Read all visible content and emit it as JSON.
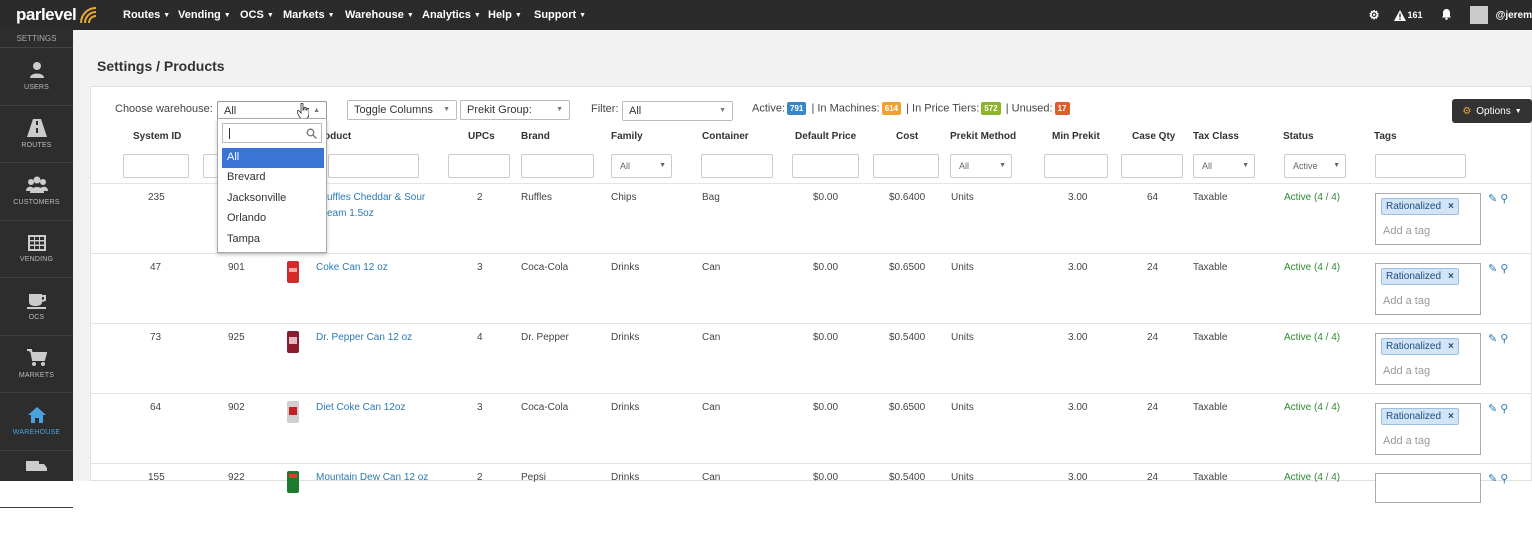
{
  "brand": {
    "name": "parlevel"
  },
  "nav": {
    "menus": [
      {
        "label": "Routes"
      },
      {
        "label": "Vending"
      },
      {
        "label": "OCS"
      },
      {
        "label": "Markets"
      },
      {
        "label": "Warehouse"
      },
      {
        "label": "Analytics"
      },
      {
        "label": "Help"
      },
      {
        "label": "Support"
      }
    ],
    "alerts_count": "161",
    "user": "@jerem"
  },
  "sidebar": {
    "header": "SETTINGS",
    "items": [
      {
        "label": "USERS",
        "icon": "user-icon"
      },
      {
        "label": "ROUTES",
        "icon": "road-icon"
      },
      {
        "label": "CUSTOMERS",
        "icon": "users-icon"
      },
      {
        "label": "VENDING",
        "icon": "grid-icon"
      },
      {
        "label": "OCS",
        "icon": "coffee-icon"
      },
      {
        "label": "MARKETS",
        "icon": "cart-icon"
      },
      {
        "label": "WAREHOUSE",
        "icon": "home-icon",
        "active": true
      },
      {
        "label": "",
        "icon": "truck-icon"
      }
    ]
  },
  "page": {
    "title": "Settings / Products"
  },
  "toolbar": {
    "warehouse_label": "Choose warehouse:",
    "warehouse_value": "All",
    "toggle_columns": "Toggle Columns",
    "prekit_group": "Prekit Group:",
    "filter_label": "Filter:",
    "filter_value": "All",
    "counts": {
      "active_label": "Active:",
      "active": "791",
      "in_machines_label": "| In Machines:",
      "in_machines": "614",
      "in_price_tiers_label": "| In Price Tiers:",
      "in_price_tiers": "572",
      "unused_label": "| Unused:",
      "unused": "17"
    },
    "options": "Options"
  },
  "warehouse_dropdown": {
    "search_placeholder": "",
    "options": [
      "All",
      "Brevard",
      "Jacksonville",
      "Orlando",
      "Tampa"
    ],
    "selected": "All"
  },
  "table": {
    "columns": [
      "System ID",
      "",
      "",
      "Product",
      "UPCs",
      "Brand",
      "Family",
      "Container",
      "Default Price",
      "Cost",
      "Prekit Method",
      "Min Prekit",
      "Case Qty",
      "Tax Class",
      "Status",
      "Tags"
    ],
    "product_header_visible": "oduct",
    "filters": {
      "family": "All",
      "prekit_method": "All",
      "tax_class": "All",
      "status": "Active"
    },
    "rows": [
      {
        "system_id": "235",
        "code": "",
        "product_line1": "uffles Cheddar & Sour",
        "product_line2": "eam 1.5oz",
        "upcs": "2",
        "brand": "Ruffles",
        "family": "Chips",
        "container": "Bag",
        "default_price": "$0.00",
        "cost": "$0.6400",
        "prekit_method": "Units",
        "min_prekit": "3.00",
        "case_qty": "64",
        "tax_class": "Taxable",
        "status": "Active (4 / 4)",
        "tag": "Rationalized",
        "add_tag": "Add a tag"
      },
      {
        "system_id": "47",
        "code": "901",
        "product_line1": "Coke Can 12 oz",
        "product_line2": "",
        "upcs": "3",
        "brand": "Coca-Cola",
        "family": "Drinks",
        "container": "Can",
        "default_price": "$0.00",
        "cost": "$0.6500",
        "prekit_method": "Units",
        "min_prekit": "3.00",
        "case_qty": "24",
        "tax_class": "Taxable",
        "status": "Active (4 / 4)",
        "tag": "Rationalized",
        "add_tag": "Add a tag"
      },
      {
        "system_id": "73",
        "code": "925",
        "product_line1": "Dr. Pepper Can 12 oz",
        "product_line2": "",
        "upcs": "4",
        "brand": "Dr. Pepper",
        "family": "Drinks",
        "container": "Can",
        "default_price": "$0.00",
        "cost": "$0.5400",
        "prekit_method": "Units",
        "min_prekit": "3.00",
        "case_qty": "24",
        "tax_class": "Taxable",
        "status": "Active (4 / 4)",
        "tag": "Rationalized",
        "add_tag": "Add a tag"
      },
      {
        "system_id": "64",
        "code": "902",
        "product_line1": "Diet Coke Can 12oz",
        "product_line2": "",
        "upcs": "3",
        "brand": "Coca-Cola",
        "family": "Drinks",
        "container": "Can",
        "default_price": "$0.00",
        "cost": "$0.6500",
        "prekit_method": "Units",
        "min_prekit": "3.00",
        "case_qty": "24",
        "tax_class": "Taxable",
        "status": "Active (4 / 4)",
        "tag": "Rationalized",
        "add_tag": "Add a tag"
      },
      {
        "system_id": "155",
        "code": "922",
        "product_line1": "Mountain Dew Can 12 oz",
        "product_line2": "",
        "upcs": "2",
        "brand": "Pepsi",
        "family": "Drinks",
        "container": "Can",
        "default_price": "$0.00",
        "cost": "$0.5400",
        "prekit_method": "Units",
        "min_prekit": "3.00",
        "case_qty": "24",
        "tax_class": "Taxable",
        "status": "Active (4 / 4)",
        "tag": "",
        "add_tag": ""
      }
    ]
  },
  "colors": {
    "active_badge": "#3a87c8",
    "machines_badge": "#f0a030",
    "tiers_badge": "#8fb32a",
    "unused_badge": "#e05c2a",
    "link": "#2a7ab5",
    "status_ok": "#2e8b2e"
  }
}
